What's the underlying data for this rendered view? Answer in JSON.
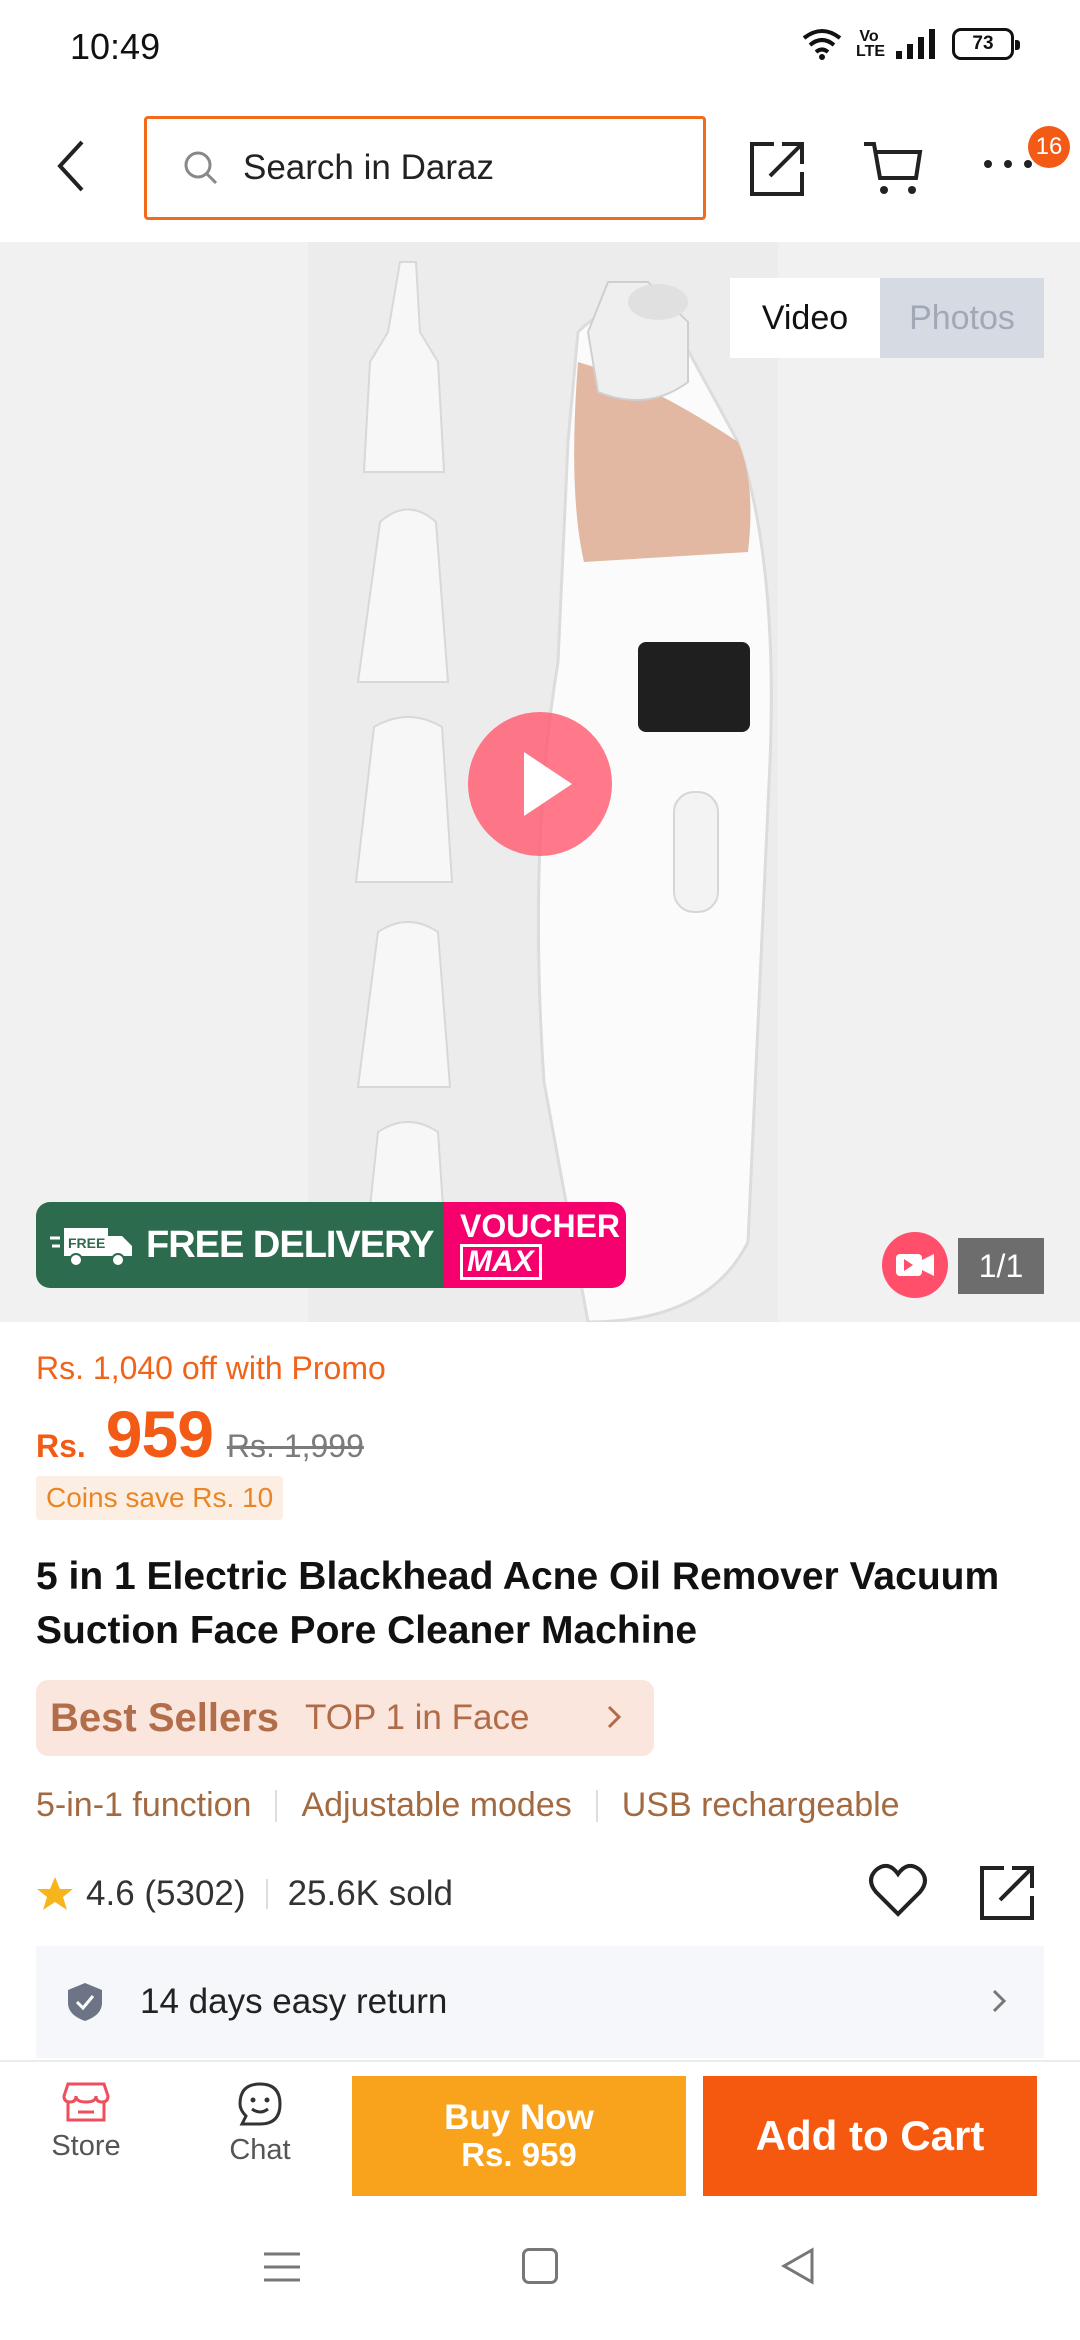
{
  "status_bar": {
    "time": "10:49",
    "volte": "Vo LTE",
    "battery": "73"
  },
  "header": {
    "search_placeholder": "Search in Daraz",
    "cart_badge": "16"
  },
  "media": {
    "tabs": [
      "Video",
      "Photos"
    ],
    "active_tab": "Video",
    "free_delivery_truck_label": "FREE",
    "free_delivery": "FREE DELIVERY",
    "voucher_line1": "VOUCHER",
    "voucher_line2": "MAX",
    "counter": "1/1"
  },
  "product": {
    "promo": "Rs. 1,040 off with Promo",
    "currency": "Rs.",
    "price": "959",
    "original_price": "Rs. 1,999",
    "coins": "Coins save Rs. 10",
    "title": "5 in 1 Electric Blackhead Acne Oil Remover Vacuum Suction Face Pore Cleaner Machine",
    "best_sellers_logo": "Best Sellers",
    "best_sellers_rank": "TOP 1 in Face",
    "features": [
      "5-in-1 function",
      "Adjustable modes",
      "USB rechargeable"
    ],
    "rating": "4.6 (5302)",
    "sold": "25.6K sold",
    "return_policy": "14 days easy return"
  },
  "bottom_bar": {
    "store": "Store",
    "chat": "Chat",
    "buy_now_line1": "Buy Now",
    "buy_now_line2": "Rs. 959",
    "add_to_cart": "Add to Cart"
  },
  "colors": {
    "brand_orange": "#f35a16",
    "buy_now": "#f9a21b",
    "free_delivery_green": "#2d6b4e",
    "voucher_pink": "#f5006d"
  }
}
